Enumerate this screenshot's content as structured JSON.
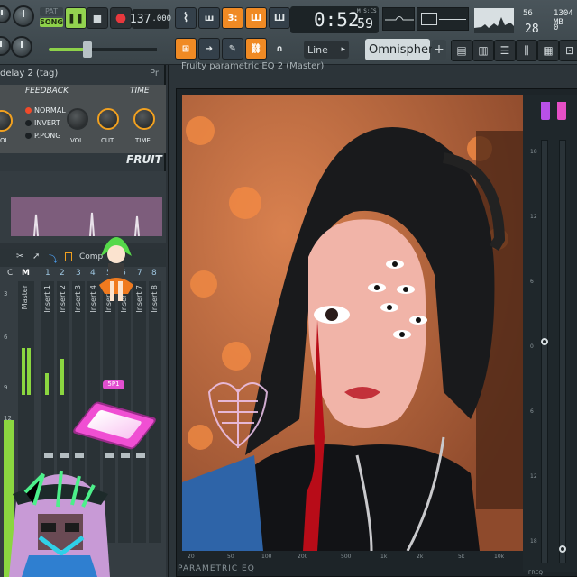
{
  "toolbar": {
    "pat_label": "PAT",
    "song_label": "SONG",
    "tempo_int": "137",
    "tempo_dec": ".000",
    "time_main": "0:52",
    "time_unit_label": "M:S:CS",
    "time_cs": "59",
    "icon_piano_roll": "3:",
    "icon_step": "ш",
    "icon_toolbar_a": "Ш",
    "icon_toolbar_b": "Ш",
    "cpu_ram_mb": "1304 MB",
    "cpu_voices": "56",
    "cpu_percent": "28",
    "cpu_suffix": "0",
    "snap_label": "Line",
    "preset_label": "Omnisphere",
    "plus_label": "+"
  },
  "delay_plugin": {
    "title": "delay 2 (tag)",
    "pr_label": "Pr",
    "feedback_label": "FEEDBACK",
    "time_label": "TIME",
    "mode_normal": "NORMAL",
    "mode_invert": "INVERT",
    "mode_pingpong": "P.PONG",
    "knob_vol": "VOL",
    "knob_cut": "CUT",
    "knob_time": "TIME",
    "knob_left": "OL",
    "brand": "FRUIT"
  },
  "mixer": {
    "tab_label": "Comp",
    "head_c": "C",
    "head_m": "M",
    "channel_numbers": [
      "1",
      "2",
      "3",
      "4",
      "5",
      "6",
      "7",
      "8"
    ],
    "channels": [
      "Master",
      "Insert 1",
      "Insert 2",
      "Insert 3",
      "Insert 4",
      "Insert 5",
      "Insert 6",
      "Insert 7",
      "Insert 8"
    ],
    "scale": [
      "3",
      "6",
      "9",
      "12",
      "15"
    ],
    "sticker_label": "5P1"
  },
  "eq": {
    "window_title": "Fruity parametric EQ 2 (Master)",
    "footer": "PARAMETRIC EQ",
    "freq_label": "FREQ",
    "scale": [
      "18",
      "12",
      "6",
      "0",
      "6",
      "12",
      "18"
    ],
    "freq_ticks": [
      "20",
      "50",
      "100",
      "200",
      "500",
      "1k",
      "2k",
      "5k",
      "10k"
    ]
  },
  "colors": {
    "accent_green": "#8dd14a",
    "accent_orange": "#f08a24",
    "accent_pink": "#f04fd3",
    "record_red": "#e8383d"
  }
}
